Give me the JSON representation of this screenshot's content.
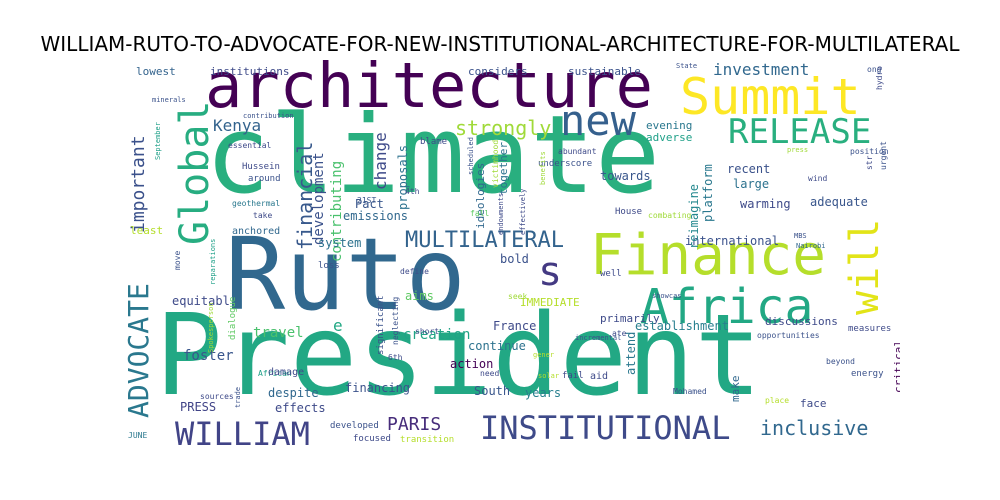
{
  "title": "WILLIAM-RUTO-TO-ADVOCATE-FOR-NEW-INSTITUTIONAL-ARCHITECTURE-FOR-MULTILATERAL",
  "words": [
    {
      "text": "President",
      "color": "#22a884"
    },
    {
      "text": "climate",
      "color": "#29af7f"
    },
    {
      "text": "Ruto",
      "color": "#31688e"
    },
    {
      "text": "architecture",
      "color": "#440154"
    },
    {
      "text": "Finance",
      "color": "#b5de2b"
    },
    {
      "text": "Africa",
      "color": "#22a884"
    },
    {
      "text": "Summit",
      "color": "#fde725"
    },
    {
      "text": "Global",
      "color": "#27ad81"
    },
    {
      "text": "new",
      "color": "#35608d"
    },
    {
      "text": "s",
      "color": "#443a83"
    },
    {
      "text": "will",
      "color": "#e2e418"
    },
    {
      "text": "RELEASE",
      "color": "#29af7f"
    },
    {
      "text": "INSTITUTIONAL",
      "color": "#3e4a89"
    },
    {
      "text": "WILLIAM",
      "color": "#414487"
    },
    {
      "text": "ADVOCATE",
      "color": "#2a788e"
    },
    {
      "text": "MULTILATERAL",
      "color": "#33638d"
    },
    {
      "text": "inclusive",
      "color": "#31688e"
    },
    {
      "text": "financial",
      "color": "#38598c"
    },
    {
      "text": "strongly",
      "color": "#a0da39"
    },
    {
      "text": "important",
      "color": "#3b518b"
    },
    {
      "text": "PARIS",
      "color": "#472d7b"
    },
    {
      "text": "Kenya",
      "color": "#33638d"
    },
    {
      "text": "investment",
      "color": "#31688e"
    },
    {
      "text": "change",
      "color": "#3e4a89"
    },
    {
      "text": "e",
      "color": "#22a884"
    },
    {
      "text": "development",
      "color": "#3b528b"
    },
    {
      "text": "contributing",
      "color": "#4ac16d"
    },
    {
      "text": "travel",
      "color": "#4ac16d"
    },
    {
      "text": "foster",
      "color": "#39568c"
    },
    {
      "text": "system",
      "color": "#2c728e"
    },
    {
      "text": "creation",
      "color": "#20a486"
    },
    {
      "text": "France",
      "color": "#3e4a89"
    },
    {
      "text": "establishment",
      "color": "#277f8e"
    },
    {
      "text": "international",
      "color": "#3b528b"
    },
    {
      "text": "platform",
      "color": "#2a788e"
    },
    {
      "text": "reimagine",
      "color": "#23888e"
    },
    {
      "text": "adequate",
      "color": "#39568c"
    },
    {
      "text": "warming",
      "color": "#3e4a89"
    },
    {
      "text": "large",
      "color": "#2c728e"
    },
    {
      "text": "recent",
      "color": "#3b528b"
    },
    {
      "text": "towards",
      "color": "#39568c"
    },
    {
      "text": "proposals",
      "color": "#2c728e"
    },
    {
      "text": "Pact",
      "color": "#39568c"
    },
    {
      "text": "emissions",
      "color": "#31688e"
    },
    {
      "text": "financing",
      "color": "#3b528b"
    },
    {
      "text": "action",
      "color": "#440154"
    },
    {
      "text": "effects",
      "color": "#3e4a89"
    },
    {
      "text": "despite",
      "color": "#31688e"
    },
    {
      "text": "PRESS",
      "color": "#414487"
    },
    {
      "text": "equitabl",
      "color": "#3e4a89"
    },
    {
      "text": "years",
      "color": "#277f8e"
    },
    {
      "text": "South",
      "color": "#39568c"
    },
    {
      "text": "IMMEDIATE",
      "color": "#b5de2b"
    },
    {
      "text": "aims",
      "color": "#5ec962"
    },
    {
      "text": "bold",
      "color": "#3b528b"
    },
    {
      "text": "continue",
      "color": "#2c728e"
    },
    {
      "text": "discussions",
      "color": "#3e4a89"
    },
    {
      "text": "face",
      "color": "#3e4a89"
    },
    {
      "text": "critical",
      "color": "#440154"
    },
    {
      "text": "attend",
      "color": "#2a788e"
    },
    {
      "text": "primarily",
      "color": "#3e4a89"
    },
    {
      "text": "make",
      "color": "#31688e"
    },
    {
      "text": "adverse",
      "color": "#1fa088"
    },
    {
      "text": "evening",
      "color": "#2a788e"
    },
    {
      "text": "together",
      "color": "#2c728e"
    },
    {
      "text": "ideologies",
      "color": "#31688e"
    },
    {
      "text": "considers",
      "color": "#3b528b"
    },
    {
      "text": "sustainable",
      "color": "#3b528b"
    },
    {
      "text": "institutions",
      "color": "#3e4a89"
    },
    {
      "text": "lowest",
      "color": "#33638d"
    },
    {
      "text": "least",
      "color": "#b5de2b"
    },
    {
      "text": "anchored",
      "color": "#31688e"
    },
    {
      "text": "take",
      "color": "#3e4a89"
    },
    {
      "text": "geothermal",
      "color": "#2a788e"
    },
    {
      "text": "around",
      "color": "#3b528b"
    },
    {
      "text": "Hussein",
      "color": "#3e4a89"
    },
    {
      "text": "essential",
      "color": "#3e4a89"
    },
    {
      "text": "contribution",
      "color": "#3b528b"
    },
    {
      "text": "minerals",
      "color": "#3b528b"
    },
    {
      "text": "September",
      "color": "#1fa088"
    },
    {
      "text": "blame",
      "color": "#3e4a89"
    },
    {
      "text": "21ST",
      "color": "#39568c"
    },
    {
      "text": "4th",
      "color": "#3e4a89"
    },
    {
      "text": "scheduled",
      "color": "#3b528b"
    },
    {
      "text": "underscore",
      "color": "#3b528b"
    },
    {
      "text": "effectively",
      "color": "#3e4a89"
    },
    {
      "text": "endowments",
      "color": "#3e4a89"
    },
    {
      "text": "benefits",
      "color": "#a0da39"
    },
    {
      "text": "abundant",
      "color": "#3e4a89"
    },
    {
      "text": "victimhood",
      "color": "#a0da39"
    },
    {
      "text": "fall",
      "color": "#5ec962"
    },
    {
      "text": "House",
      "color": "#3e4a89"
    },
    {
      "text": "combating",
      "color": "#a0da39"
    },
    {
      "text": "MBS",
      "color": "#3b528b"
    },
    {
      "text": "Nairobi",
      "color": "#31688e"
    },
    {
      "text": "wind",
      "color": "#3e4a89"
    },
    {
      "text": "position",
      "color": "#3b528b"
    },
    {
      "text": "urgent",
      "color": "#3b528b"
    },
    {
      "text": "str",
      "color": "#3e4a89"
    },
    {
      "text": "hydro",
      "color": "#3e4a89"
    },
    {
      "text": "ong",
      "color": "#3b528b"
    },
    {
      "text": "State",
      "color": "#3b528b"
    },
    {
      "text": "press",
      "color": "#a0da39"
    },
    {
      "text": "reparations",
      "color": "#1fa088"
    },
    {
      "text": "move",
      "color": "#3b528b"
    },
    {
      "text": "loss",
      "color": "#3b528b"
    },
    {
      "text": "define",
      "color": "#3e4a89"
    },
    {
      "text": "well",
      "color": "#3e4a89"
    },
    {
      "text": "seek",
      "color": "#a0da39"
    },
    {
      "text": "showcas",
      "color": "#3b528b"
    },
    {
      "text": "significant",
      "color": "#3b528b"
    },
    {
      "text": "neglecting",
      "color": "#3b528b"
    },
    {
      "text": "short",
      "color": "#3e4a89"
    },
    {
      "text": "ate",
      "color": "#3e4a89"
    },
    {
      "text": "incremental",
      "color": "#3b528b"
    },
    {
      "text": "opportunities",
      "color": "#3b528b"
    },
    {
      "text": "measures",
      "color": "#3e4a89"
    },
    {
      "text": "beyond",
      "color": "#3b528b"
    },
    {
      "text": "energy",
      "color": "#3b528b"
    },
    {
      "text": "6th",
      "color": "#3e4a89"
    },
    {
      "text": "dialogue",
      "color": "#5ec962"
    },
    {
      "text": "African",
      "color": "#1fa088"
    },
    {
      "text": "Spokesperson",
      "color": "#a0da39"
    },
    {
      "text": "damage",
      "color": "#3e4a89"
    },
    {
      "text": "solar",
      "color": "#b5de2b"
    },
    {
      "text": "gener",
      "color": "#b5de2b"
    },
    {
      "text": "fail",
      "color": "#3e4a89"
    },
    {
      "text": "need",
      "color": "#3e4a89"
    },
    {
      "text": "aid",
      "color": "#3e4a89"
    },
    {
      "text": "Mohamed",
      "color": "#3b528b"
    },
    {
      "text": "place",
      "color": "#b5de2b"
    },
    {
      "text": "sources",
      "color": "#3e4a89"
    },
    {
      "text": "trade",
      "color": "#3b528b"
    },
    {
      "text": "JUNE",
      "color": "#2a788e"
    },
    {
      "text": "developed",
      "color": "#3b528b"
    },
    {
      "text": "focused",
      "color": "#3e4a89"
    },
    {
      "text": "transition",
      "color": "#b5de2b"
    }
  ]
}
